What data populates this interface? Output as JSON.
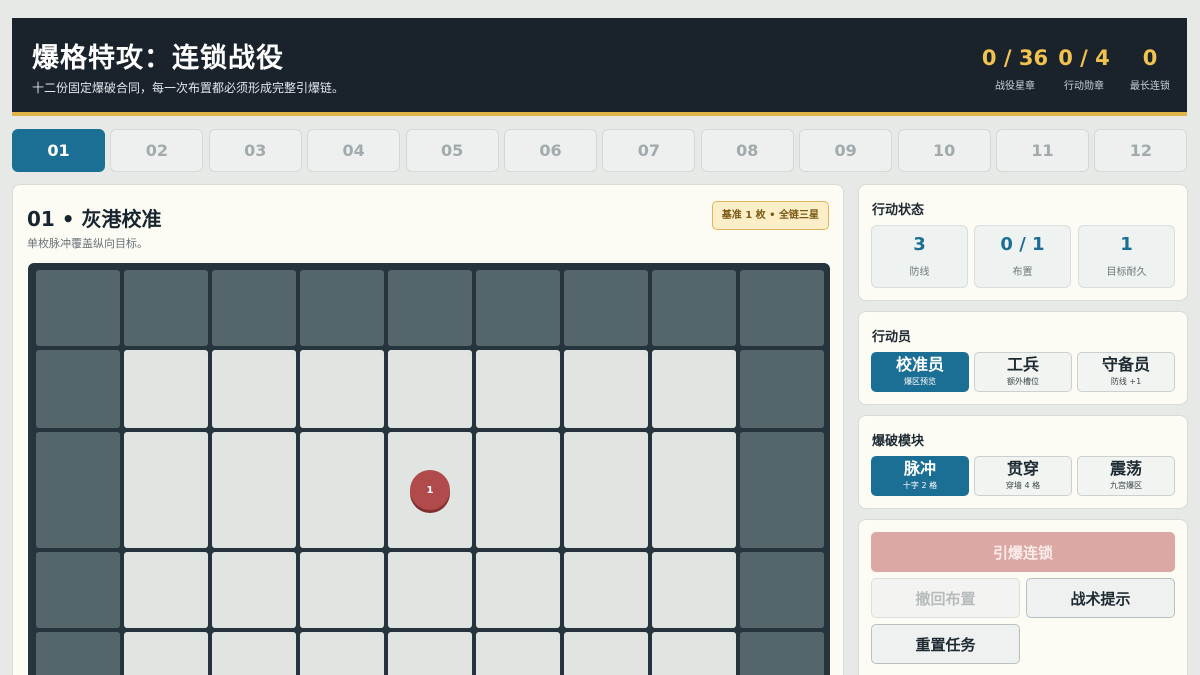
{
  "header": {
    "title": "爆格特攻：连锁战役",
    "subtitle": "十二份固定爆破合同，每一次布置都必须形成完整引爆链。",
    "stats": [
      {
        "value": "0 / 36",
        "label": "战役星章"
      },
      {
        "value": "0 / 4",
        "label": "行动勋章"
      },
      {
        "value": "0",
        "label": "最长连锁"
      }
    ]
  },
  "tabs": [
    "01",
    "02",
    "03",
    "04",
    "05",
    "06",
    "07",
    "08",
    "09",
    "10",
    "11",
    "12"
  ],
  "active_tab": "01",
  "mission": {
    "title": "01 • 灰港校准",
    "description": "单枚脉冲覆盖纵向目标。",
    "badge": "基准 1 枚 • 全链三星"
  },
  "board": {
    "visible_rows": [
      [
        "wall",
        "wall",
        "wall",
        "wall",
        "wall",
        "wall",
        "wall",
        "wall",
        "wall"
      ],
      [
        "wall",
        "floor",
        "floor",
        "floor",
        "floor",
        "floor",
        "floor",
        "floor",
        "wall"
      ],
      [
        "wall",
        "floor",
        "floor",
        "floor",
        "floor",
        "floor",
        "floor",
        "floor",
        "wall"
      ],
      [
        "wall",
        "floor",
        "floor",
        "floor",
        "floor",
        "floor",
        "floor",
        "floor",
        "wall"
      ],
      [
        "wall",
        "floor",
        "floor",
        "floor",
        "floor",
        "floor",
        "floor",
        "floor",
        "wall"
      ]
    ],
    "targets": [
      {
        "row": 2,
        "col": 4,
        "label": "1"
      }
    ]
  },
  "status": {
    "title": "行动状态",
    "items": [
      {
        "value": "3",
        "label": "防线"
      },
      {
        "value": "0 / 1",
        "label": "布置"
      },
      {
        "value": "1",
        "label": "目标耐久"
      }
    ]
  },
  "operators": {
    "title": "行动员",
    "options": [
      {
        "name": "校准员",
        "sub": "爆区预览",
        "active": true
      },
      {
        "name": "工兵",
        "sub": "额外槽位",
        "active": false
      },
      {
        "name": "守备员",
        "sub": "防线 +1",
        "active": false
      }
    ]
  },
  "modules": {
    "title": "爆破模块",
    "options": [
      {
        "name": "脉冲",
        "sub": "十字 2 格",
        "active": true
      },
      {
        "name": "贯穿",
        "sub": "穿墙 4 格",
        "active": false
      },
      {
        "name": "震荡",
        "sub": "九宫爆区",
        "active": false
      }
    ]
  },
  "actions": {
    "detonate": "引爆连锁",
    "undo": "撤回布置",
    "hint": "战术提示",
    "reset": "重置任务"
  },
  "colors": {
    "header_bg": "#1a232b",
    "accent_gold": "#f1c250",
    "primary_blue": "#1c6f94",
    "target_red": "#b14a4a",
    "wall": "#55666b",
    "floor": "#e0e5e1"
  }
}
